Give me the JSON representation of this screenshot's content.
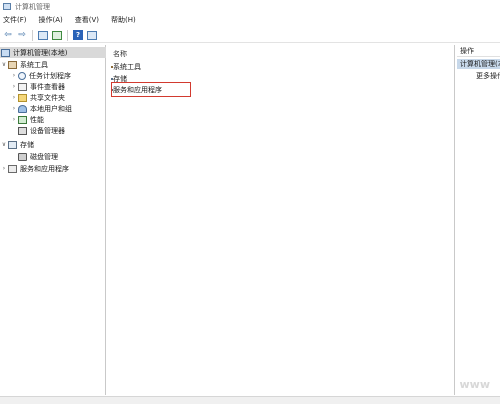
{
  "window": {
    "title": "计算机管理"
  },
  "menu": {
    "file": "文件(F)",
    "action": "操作(A)",
    "view": "查看(V)",
    "help": "帮助(H)"
  },
  "toolbar": {
    "help_label": "?"
  },
  "tree": {
    "root": "计算机管理(本地)",
    "system_tools": "系统工具",
    "task_scheduler": "任务计划程序",
    "event_viewer": "事件查看器",
    "shared_folders": "共享文件夹",
    "local_users": "本地用户和组",
    "performance": "性能",
    "device_manager": "设备管理器",
    "storage": "存储",
    "disk_management": "磁盘管理",
    "services_apps": "服务和应用程序"
  },
  "list": {
    "column_name": "名称",
    "items": [
      "系统工具",
      "存储",
      "服务和应用程序"
    ]
  },
  "actions": {
    "header": "操作",
    "section": "计算机管理(本地)",
    "more": "更多操作"
  },
  "watermark": "www"
}
